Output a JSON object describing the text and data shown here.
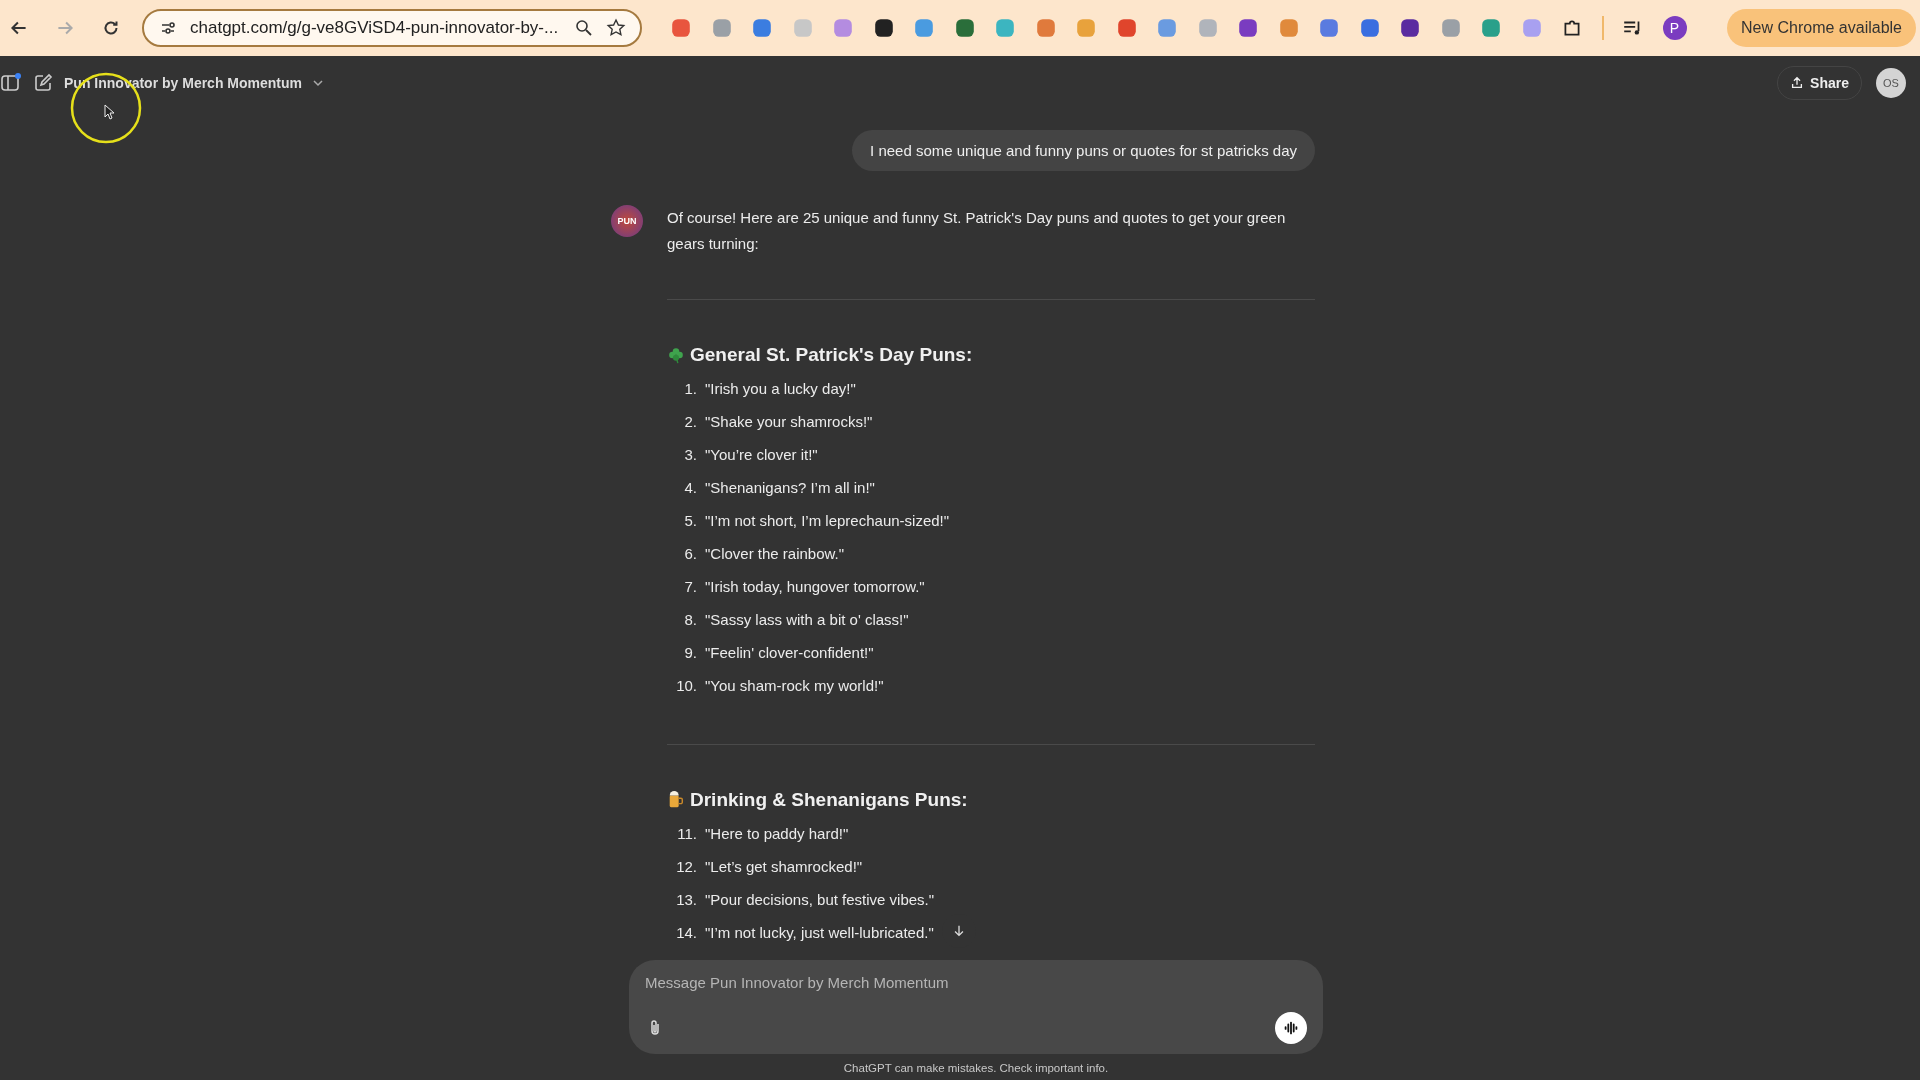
{
  "browser": {
    "url": "chatgpt.com/g/g-ve8GViSD4-pun-innovator-by-...",
    "update_label": "New Chrome available",
    "profile_initial": "P"
  },
  "header": {
    "title": "Pun Innovator by Merch Momentum",
    "share_label": "Share",
    "avatar_initials": "OS"
  },
  "user_message": "I need some unique and funny puns or quotes for st patricks day",
  "assistant": {
    "avatar_label": "PUN",
    "intro": "Of course! Here are 25 unique and funny St. Patrick's Day puns and quotes to get your green gears turning:",
    "sections": [
      {
        "kind": "clover",
        "heading": "General St. Patrick's Day Puns:",
        "items": [
          {
            "number": "1.",
            "text": "\"Irish you a lucky day!\""
          },
          {
            "number": "2.",
            "text": "\"Shake your shamrocks!\""
          },
          {
            "number": "3.",
            "text": "\"You’re clover it!\""
          },
          {
            "number": "4.",
            "text": "\"Shenanigans? I’m all in!\""
          },
          {
            "number": "5.",
            "text": "\"I’m not short, I’m leprechaun-sized!\""
          },
          {
            "number": "6.",
            "text": "\"Clover the rainbow.\""
          },
          {
            "number": "7.",
            "text": "\"Irish today, hungover tomorrow.\""
          },
          {
            "number": "8.",
            "text": "\"Sassy lass with a bit o' class!\""
          },
          {
            "number": "9.",
            "text": "\"Feelin' clover-confident!\""
          },
          {
            "number": "10.",
            "text": "\"You sham-rock my world!\""
          }
        ]
      },
      {
        "kind": "beer",
        "heading": "Drinking & Shenanigans Puns:",
        "items": [
          {
            "number": "11.",
            "text": "\"Here to paddy hard!\""
          },
          {
            "number": "12.",
            "text": "\"Let’s get shamrocked!\""
          },
          {
            "number": "13.",
            "text": "\"Pour decisions, but festive vibes.\""
          },
          {
            "number": "14.",
            "text": "\"I’m not lucky, just well-lubricated.\""
          }
        ]
      }
    ]
  },
  "composer": {
    "placeholder": "Message Pun Innovator by Merch Momentum"
  },
  "disclaimer": "ChatGPT can make mistakes. Check important info."
}
